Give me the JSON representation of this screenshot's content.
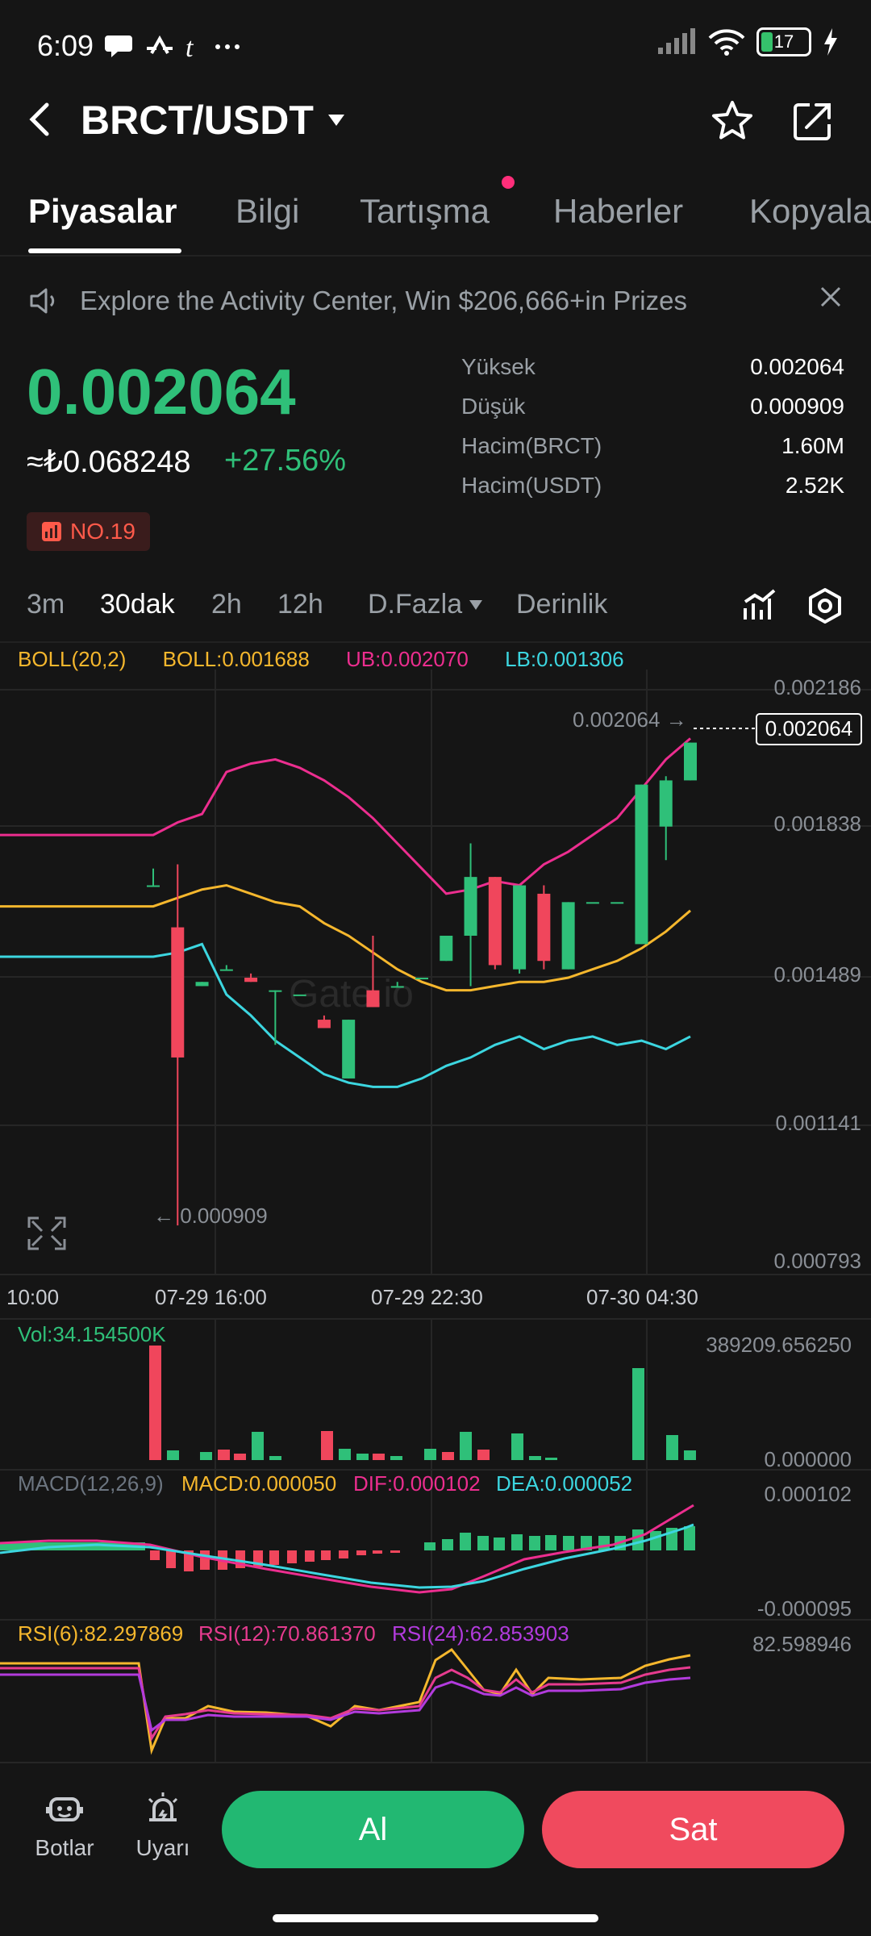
{
  "status_bar": {
    "time": "6:09",
    "left_icons": "💬 ⤳ 𝓽 ⋯",
    "battery": "17"
  },
  "header": {
    "title": "BRCT/USDT"
  },
  "tabs": [
    "Piyasalar",
    "Bilgi",
    "Tartışma",
    "Haberler",
    "Kopyala"
  ],
  "banner": {
    "text": "Explore the Activity Center, Win $206,666+in Prizes"
  },
  "ticker": {
    "price": "0.002064",
    "fiat": "≈₺0.068248",
    "change": "+27.56%",
    "rank": "NO.19"
  },
  "stats": [
    {
      "label": "Yüksek",
      "value": "0.002064"
    },
    {
      "label": "Düşük",
      "value": "0.000909"
    },
    {
      "label": "Hacim(BRCT)",
      "value": "1.60M"
    },
    {
      "label": "Hacim(USDT)",
      "value": "2.52K"
    }
  ],
  "intervals": [
    "3m",
    "30dak",
    "2h",
    "12h",
    "D.Fazla",
    "Derinlik"
  ],
  "boll_legend": {
    "a": "BOLL(20,2)",
    "b": "BOLL:0.001688",
    "c": "UB:0.002070",
    "d": "LB:0.001306"
  },
  "price_axis": [
    "0.002186",
    "0.001838",
    "0.001489",
    "0.001141",
    "0.000793"
  ],
  "time_axis": [
    "10:00",
    "07-29 16:00",
    "07-29 22:30",
    "07-30 04:30"
  ],
  "last_price_tag": "0.002064",
  "high_marker": "0.002064 →",
  "low_marker": "← 0.000909",
  "watermark": "Gate.io",
  "vol": {
    "label": "Vol:34.154500K",
    "max": "389209.656250",
    "min": "0.000000"
  },
  "macd": {
    "a": "MACD(12,26,9)",
    "b": "MACD:0.000050",
    "c": "DIF:0.000102",
    "d": "DEA:0.000052",
    "max": "0.000102",
    "min": "-0.000095"
  },
  "rsi": {
    "a": "RSI(6):82.297869",
    "b": "RSI(12):70.861370",
    "c": "RSI(24):62.853903",
    "max": "82.598946"
  },
  "bottom": {
    "bots": "Botlar",
    "alerts": "Uyarı",
    "buy": "Al",
    "sell": "Sat"
  },
  "colors": {
    "up": "#2fc079",
    "down": "#f0465c",
    "boll_mid": "#f5b72d",
    "boll_ub": "#ec2e8f",
    "boll_lb": "#3cd6e0",
    "rsi12": "#e63b8f",
    "rsi24": "#b23bdd"
  },
  "chart_data": {
    "type": "candlestick",
    "interval": "30dak",
    "candles": [
      {
        "o": 0.00172,
        "h": 0.00176,
        "l": 0.00172,
        "c": 0.00172
      },
      {
        "o": 0.00162,
        "h": 0.00177,
        "l": 0.00091,
        "c": 0.00131
      },
      {
        "o": 0.00148,
        "h": 0.00149,
        "l": 0.00148,
        "c": 0.00149
      },
      {
        "o": 0.00152,
        "h": 0.00153,
        "l": 0.00152,
        "c": 0.00152
      },
      {
        "o": 0.0015,
        "h": 0.00151,
        "l": 0.00149,
        "c": 0.00149
      },
      {
        "o": 0.00147,
        "h": 0.00147,
        "l": 0.00134,
        "c": 0.00147
      },
      {
        "o": 0.00146,
        "h": 0.00146,
        "l": 0.00146,
        "c": 0.00146
      },
      {
        "o": 0.0014,
        "h": 0.00141,
        "l": 0.00138,
        "c": 0.00138
      },
      {
        "o": 0.00126,
        "h": 0.0014,
        "l": 0.00126,
        "c": 0.0014
      },
      {
        "o": 0.00147,
        "h": 0.0016,
        "l": 0.00143,
        "c": 0.00143
      },
      {
        "o": 0.00148,
        "h": 0.00149,
        "l": 0.00148,
        "c": 0.00148
      },
      {
        "o": 0.0015,
        "h": 0.0015,
        "l": 0.0015,
        "c": 0.0015
      },
      {
        "o": 0.00154,
        "h": 0.0016,
        "l": 0.00154,
        "c": 0.0016
      },
      {
        "o": 0.0016,
        "h": 0.00182,
        "l": 0.00148,
        "c": 0.00174
      },
      {
        "o": 0.00174,
        "h": 0.00174,
        "l": 0.00152,
        "c": 0.00153
      },
      {
        "o": 0.00152,
        "h": 0.00172,
        "l": 0.00151,
        "c": 0.00172
      },
      {
        "o": 0.0017,
        "h": 0.00172,
        "l": 0.00152,
        "c": 0.00154
      },
      {
        "o": 0.00152,
        "h": 0.00168,
        "l": 0.00152,
        "c": 0.00168
      },
      {
        "o": 0.00168,
        "h": 0.00168,
        "l": 0.00168,
        "c": 0.00168
      },
      {
        "o": 0.00168,
        "h": 0.00168,
        "l": 0.00168,
        "c": 0.00168
      },
      {
        "o": 0.00158,
        "h": 0.00196,
        "l": 0.00158,
        "c": 0.00196
      },
      {
        "o": 0.00186,
        "h": 0.00198,
        "l": 0.00178,
        "c": 0.00197
      },
      {
        "o": 0.00197,
        "h": 0.00206,
        "l": 0.00197,
        "c": 0.00206
      }
    ],
    "price_axis_range": [
      0.000793,
      0.002186
    ],
    "boll": {
      "mid": [
        0.00167,
        0.00169,
        0.00171,
        0.00172,
        0.0017,
        0.00168,
        0.00167,
        0.00163,
        0.0016,
        0.00156,
        0.00152,
        0.00149,
        0.00147,
        0.00147,
        0.00148,
        0.00149,
        0.00149,
        0.0015,
        0.00152,
        0.00154,
        0.00157,
        0.00161,
        0.00166
      ],
      "ub": [
        0.00184,
        0.00187,
        0.00189,
        0.00199,
        0.00201,
        0.00202,
        0.002,
        0.00197,
        0.00193,
        0.00188,
        0.00182,
        0.00176,
        0.0017,
        0.00171,
        0.00173,
        0.00172,
        0.00177,
        0.0018,
        0.00184,
        0.00188,
        0.00195,
        0.00202,
        0.00207
      ],
      "lb": [
        0.00155,
        0.00156,
        0.00158,
        0.00146,
        0.00141,
        0.00135,
        0.00131,
        0.00127,
        0.00125,
        0.00124,
        0.00124,
        0.00126,
        0.00129,
        0.00131,
        0.00134,
        0.00136,
        0.00133,
        0.00135,
        0.00136,
        0.00134,
        0.00135,
        0.00133,
        0.00136
      ]
    }
  }
}
